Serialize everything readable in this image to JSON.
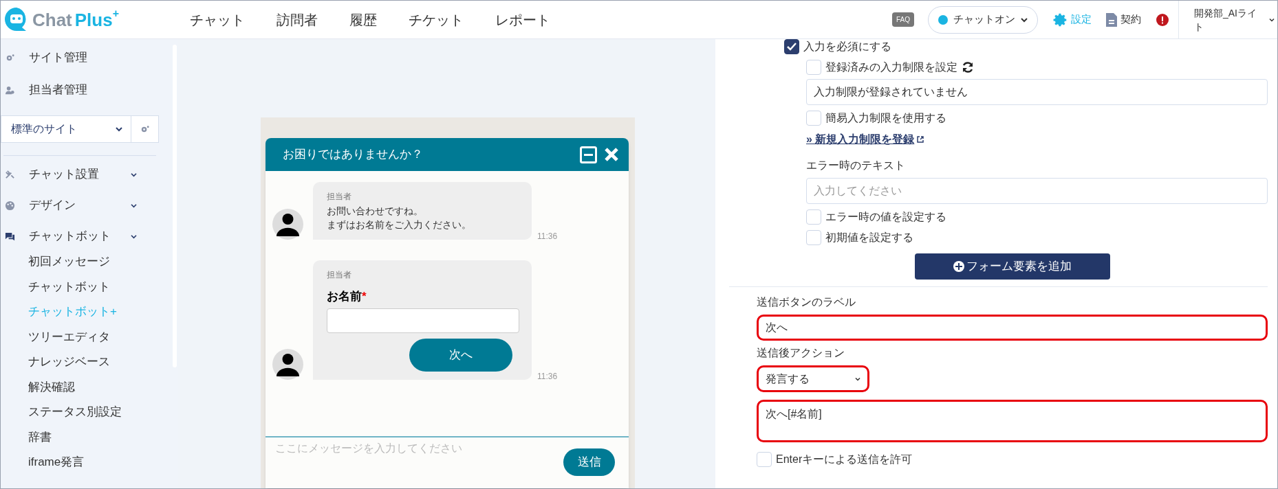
{
  "header": {
    "logo": {
      "word1": "Chat",
      "word2": "Plus",
      "mark": "+"
    },
    "nav": [
      "チャット",
      "訪問者",
      "履歴",
      "チケット",
      "レポート"
    ],
    "faq": "FAQ",
    "status": {
      "label": "チャットオン",
      "on": true
    },
    "settings": "設定",
    "contract": "契約",
    "user": [
      "開発部_AIライ",
      "ト"
    ]
  },
  "sidebar": {
    "top_items": [
      {
        "label": "サイト管理"
      },
      {
        "label": "担当者管理"
      }
    ],
    "site_select": {
      "value": "標準のサイト"
    },
    "groups": [
      {
        "label": "チャット設置"
      },
      {
        "label": "デザイン"
      },
      {
        "label": "チャットボット",
        "children": [
          {
            "label": "初回メッセージ",
            "selected": false
          },
          {
            "label": "チャットボット",
            "selected": false
          },
          {
            "label": "チャットボット+",
            "selected": true
          },
          {
            "label": "ツリーエディタ",
            "selected": false
          },
          {
            "label": "ナレッジベース",
            "selected": false
          },
          {
            "label": "解決確認",
            "selected": false
          },
          {
            "label": "ステータス別設定",
            "selected": false
          },
          {
            "label": "辞書",
            "selected": false
          },
          {
            "label": "iframe発言",
            "selected": false
          }
        ]
      }
    ]
  },
  "chat_preview": {
    "title": "お困りではありませんか？",
    "messages": [
      {
        "kind": "text",
        "sender": "担当者",
        "lines": [
          "お問い合わせですね。",
          "まずはお名前をご入力ください。"
        ],
        "time": "11:36"
      },
      {
        "kind": "form",
        "sender": "担当者",
        "field_label": "お名前",
        "required_mark": "*",
        "button": "次へ",
        "time": "11:36"
      }
    ],
    "input_placeholder": "ここにメッセージを入力してください",
    "send_button": "送信"
  },
  "settings_panel": {
    "items": [
      {
        "kind": "checkbox",
        "label": "入力を必須にする",
        "checked": true,
        "children": [
          {
            "kind": "checkbox",
            "label": "登録済みの入力制限を設定",
            "checked": false,
            "refresh": true
          },
          {
            "kind": "field",
            "value": "入力制限が登録されていません"
          },
          {
            "kind": "checkbox",
            "label": "簡易入力制限を使用する",
            "checked": false
          },
          {
            "kind": "link",
            "label": "» 新規入力制限を登録"
          },
          {
            "kind": "label",
            "label": "エラー時のテキスト"
          },
          {
            "kind": "field",
            "placeholder": "入力してください"
          },
          {
            "kind": "checkbox",
            "label": "エラー時の値を設定する",
            "checked": false
          },
          {
            "kind": "checkbox",
            "label": "初期値を設定する",
            "checked": false
          }
        ]
      },
      {
        "kind": "button",
        "label": "フォーム要素を追加"
      },
      {
        "kind": "divider"
      },
      {
        "kind": "label",
        "label": "送信ボタンのラベル"
      },
      {
        "kind": "field",
        "value": "次へ",
        "highlighted": true
      },
      {
        "kind": "label",
        "label": "送信後アクション"
      },
      {
        "kind": "select",
        "value": "発言する",
        "highlighted": true
      },
      {
        "kind": "textarea",
        "value": "次へ[#名前]",
        "highlighted": true
      },
      {
        "kind": "checkbox",
        "label": "Enterキーによる送信を許可",
        "checked": false
      }
    ]
  }
}
